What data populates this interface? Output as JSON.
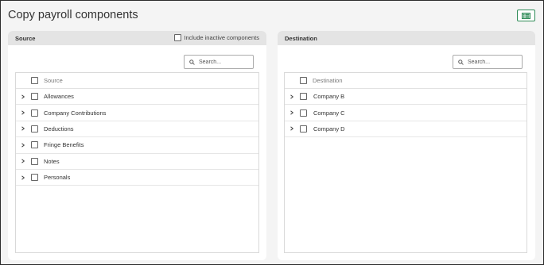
{
  "page": {
    "title": "Copy payroll components"
  },
  "toolbar": {
    "export_icon": "spreadsheet-icon",
    "accent_color": "#2e8b57"
  },
  "source": {
    "header": "Source",
    "include_inactive_label": "Include inactive components",
    "search_placeholder": "Search...",
    "column_header": "Source",
    "items": [
      {
        "label": "Allowances"
      },
      {
        "label": "Company Contributions"
      },
      {
        "label": "Deductions"
      },
      {
        "label": "Fringe Benefits"
      },
      {
        "label": "Notes"
      },
      {
        "label": "Personals"
      }
    ]
  },
  "destination": {
    "header": "Destination",
    "search_placeholder": "Search...",
    "column_header": "Destination",
    "items": [
      {
        "label": "Company B"
      },
      {
        "label": "Company C"
      },
      {
        "label": "Company D"
      }
    ]
  }
}
